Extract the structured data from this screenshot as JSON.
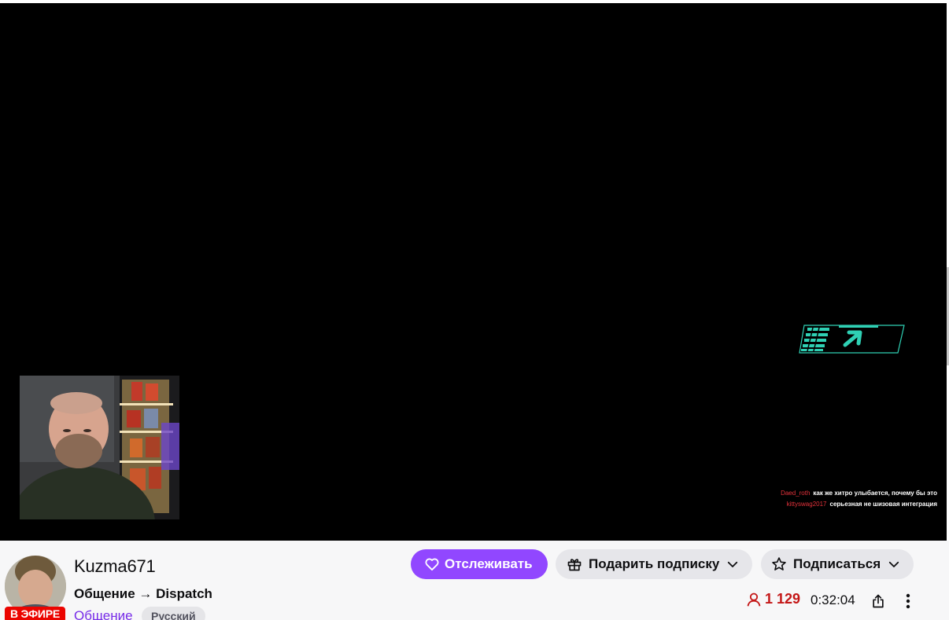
{
  "overlay_chat": [
    {
      "user": "Daed_roth",
      "message": "как же хитро улыбается, почему бы это"
    },
    {
      "user": "kittyswag2017",
      "message": "серьезная не шизовая интеграция"
    }
  ],
  "channel": {
    "name": "Kuzma671",
    "live_badge": "В ЭФИРЕ",
    "title": "Общение → Dispatch",
    "category": "Общение",
    "tag": "Русский"
  },
  "actions": {
    "follow_label": "Отслеживать",
    "gift_label": "Подарить подписку",
    "subscribe_label": "Подписаться"
  },
  "stats": {
    "viewers": "1 129",
    "uptime": "0:32:04"
  },
  "colors": {
    "brand": "#9147ff",
    "live": "#eb0400",
    "viewers": "#c41717",
    "hud": "#2fd0b4"
  }
}
